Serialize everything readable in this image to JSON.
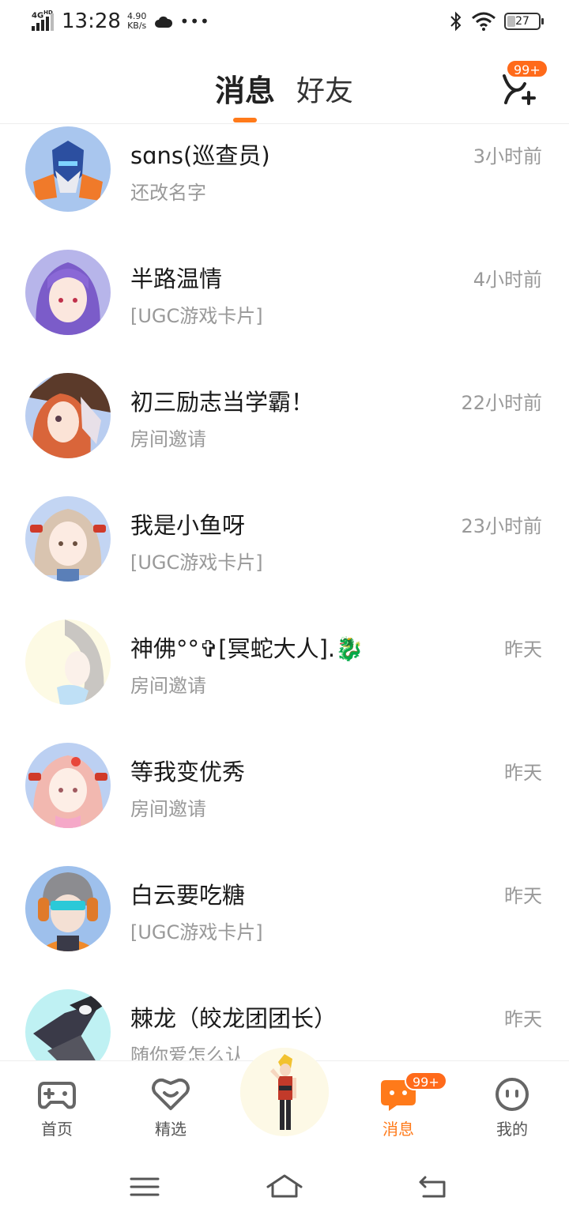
{
  "status_bar": {
    "network": "4G HD",
    "time": "13:28",
    "speed_value": "4.90",
    "speed_unit": "KB/s",
    "battery": "27",
    "battery_level": 0.27
  },
  "header": {
    "tab_messages": "消息",
    "tab_friends": "好友",
    "badge": "99+",
    "accent_color": "#ff7a1a"
  },
  "conversations": [
    {
      "name": "sɑns(巡查员)",
      "preview": "还改名字",
      "time": "3小时前",
      "avatar_color": "#a9c6ee"
    },
    {
      "name": "半路温情",
      "preview": "[UGC游戏卡片]",
      "time": "4小时前",
      "avatar_color": "#b7b5ea"
    },
    {
      "name": "初三励志当学霸！",
      "preview": "房间邀请",
      "time": "22小时前",
      "avatar_color": "#b9cdf0"
    },
    {
      "name": "我是小鱼呀",
      "preview": "[UGC游戏卡片]",
      "time": "23小时前",
      "avatar_color": "#c3d5f3"
    },
    {
      "name": "神佛°°✞[冥蛇大人].🐉",
      "preview": "房间邀请",
      "time": "昨天",
      "avatar_color": "#fdfae4"
    },
    {
      "name": "等我变优秀",
      "preview": "房间邀请",
      "time": "昨天",
      "avatar_color": "#bcd0f2"
    },
    {
      "name": "白云要吃糖",
      "preview": "[UGC游戏卡片]",
      "time": "昨天",
      "avatar_color": "#9ec0ec"
    },
    {
      "name": "棘龙（皎龙团团长）",
      "preview": "随你爱怎么认",
      "time": "昨天",
      "avatar_color": "#bff1f3"
    }
  ],
  "bottom_nav": {
    "home": "首页",
    "featured": "精选",
    "messages": "消息",
    "me": "我的",
    "messages_badge": "99+"
  }
}
